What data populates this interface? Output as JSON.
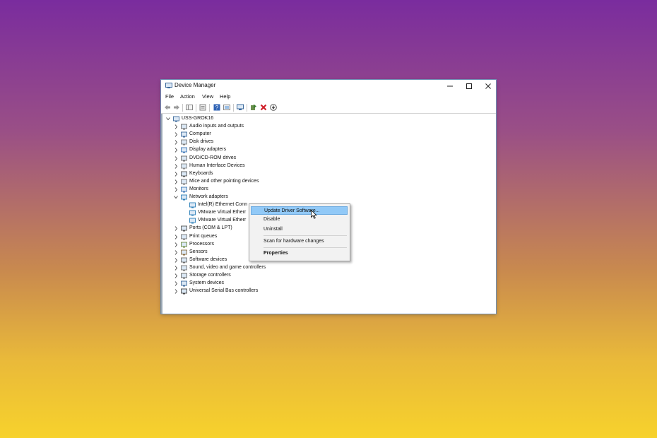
{
  "window": {
    "title": "Device Manager",
    "controls": {
      "minimize": "—",
      "maximize": "☐",
      "close": "✕"
    }
  },
  "menu": [
    "File",
    "Action",
    "View",
    "Help"
  ],
  "toolbar": {
    "icons": [
      "back-arrow-icon",
      "forward-arrow-icon",
      "show-hide-tree-icon",
      "properties-icon",
      "help-icon",
      "view-icon",
      "monitor-scan-icon",
      "update-driver-icon",
      "uninstall-icon",
      "download-icon"
    ]
  },
  "tree": {
    "root": "USS-GROK16",
    "categories": [
      "Audio inputs and outputs",
      "Computer",
      "Disk drives",
      "Display adapters",
      "DVD/CD-ROM drives",
      "Human Interface Devices",
      "Keyboards",
      "Mice and other pointing devices",
      "Monitors",
      "Network adapters",
      "Ports (COM & LPT)",
      "Print queues",
      "Processors",
      "Sensors",
      "Software devices",
      "Sound, video and game controllers",
      "Storage controllers",
      "System devices",
      "Universal Serial Bus controllers"
    ],
    "network_children": [
      "Intel(R) Ethernet Conn",
      "VMware Virtual Etherr",
      "VMware Virtual Etherr"
    ]
  },
  "context_menu": {
    "items": [
      "Update Driver Software...",
      "Disable",
      "Uninstall",
      "Scan for hardware changes",
      "Properties"
    ],
    "highlighted_index": 0
  },
  "colors": {
    "menu_highlight": "#91c9f7",
    "background_top": "#7a2c9e",
    "background_bottom": "#f7d22c"
  }
}
